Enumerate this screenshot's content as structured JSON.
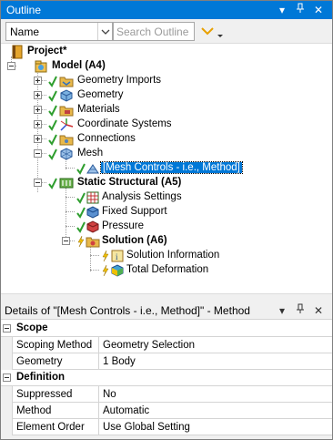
{
  "outline": {
    "title": "Outline",
    "buttons": {
      "dropdown": "▾",
      "pin": "⊣",
      "close": "✕"
    }
  },
  "toolbar": {
    "name_select": "Name",
    "search_placeholder": "Search Outline"
  },
  "tree": {
    "project": "Project*",
    "model": "Model (A4)",
    "geometry_imports": "Geometry Imports",
    "geometry": "Geometry",
    "materials": "Materials",
    "coordinate_systems": "Coordinate Systems",
    "connections": "Connections",
    "mesh": "Mesh",
    "mesh_controls": "[Mesh Controls - i.e., Method]",
    "static_structural": "Static Structural (A5)",
    "analysis_settings": "Analysis Settings",
    "fixed_support": "Fixed Support",
    "pressure": "Pressure",
    "solution": "Solution (A6)",
    "solution_information": "Solution Information",
    "total_deformation": "Total Deformation"
  },
  "details": {
    "title": "Details of \"[Mesh Controls - i.e., Method]\" - Method",
    "groups": [
      {
        "label": "Scope",
        "rows": [
          {
            "property": "Scoping Method",
            "value": "Geometry Selection"
          },
          {
            "property": "Geometry",
            "value": "1 Body"
          }
        ]
      },
      {
        "label": "Definition",
        "rows": [
          {
            "property": "Suppressed",
            "value": "No"
          },
          {
            "property": "Method",
            "value": "Automatic"
          },
          {
            "property": "Element Order",
            "value": "Use Global Setting"
          }
        ]
      }
    ]
  },
  "colors": {
    "titlebar": "#0078d7",
    "selection": "#0078d7",
    "check": "#2e9e2e",
    "folder": "#e8b84a"
  }
}
